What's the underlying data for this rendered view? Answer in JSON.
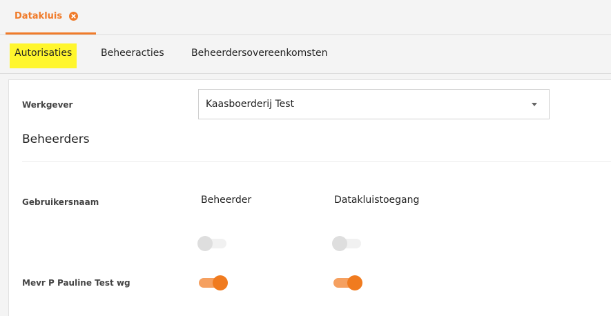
{
  "app_tabs": [
    {
      "label": "Datakluis"
    }
  ],
  "sub_tabs": [
    {
      "label": "Autorisaties"
    },
    {
      "label": "Beheeracties"
    },
    {
      "label": "Beheerdersovereenkomsten"
    }
  ],
  "form": {
    "werkgever_label": "Werkgever",
    "werkgever_value": "Kaasboerderij Test"
  },
  "section": {
    "title": "Beheerders"
  },
  "table": {
    "headers": {
      "user": "Gebruikersnaam",
      "admin": "Beheerder",
      "vault": "Datakluistoegang"
    },
    "rows": [
      {
        "name": "",
        "beheerder": false,
        "datakluistoegang": false
      },
      {
        "name": "Mevr P Pauline Test wg",
        "beheerder": true,
        "datakluistoegang": true
      }
    ]
  },
  "colors": {
    "accent": "#f07b2a",
    "highlight": "#fff62d"
  }
}
